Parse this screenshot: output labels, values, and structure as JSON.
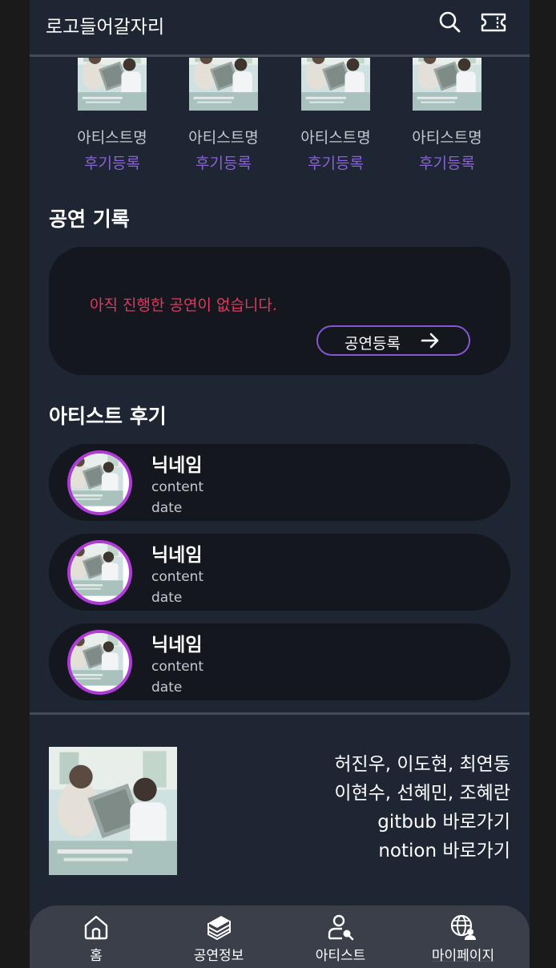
{
  "header": {
    "logo": "로고들어갈자리",
    "search_icon": "search-icon",
    "ticket_icon": "ticket-icon"
  },
  "thumbs": [
    {
      "name": "아티스트명",
      "review": "후기등록"
    },
    {
      "name": "아티스트명",
      "review": "후기등록"
    },
    {
      "name": "아티스트명",
      "review": "후기등록"
    },
    {
      "name": "아티스트명",
      "review": "후기등록"
    }
  ],
  "performance": {
    "title": "공연 기록",
    "empty_message": "아직 진행한 공연이 없습니다.",
    "register_label": "공연등록"
  },
  "reviews": {
    "title": "아티스트 후기",
    "items": [
      {
        "nickname": "닉네임",
        "content": "content",
        "date": "date"
      },
      {
        "nickname": "닉네임",
        "content": "content",
        "date": "date"
      },
      {
        "nickname": "닉네임",
        "content": "content",
        "date": "date"
      }
    ]
  },
  "footer": {
    "members_line1": "허진우, 이도현, 최연동",
    "members_line2": "이현수, 선혜민, 조혜란",
    "github_link": "gitbub 바로가기",
    "notion_link": "notion 바로가기"
  },
  "nav": {
    "items": [
      {
        "label": "홈",
        "icon": "home-icon"
      },
      {
        "label": "공연정보",
        "icon": "performance-stack-icon"
      },
      {
        "label": "아티스트",
        "icon": "artist-search-icon"
      },
      {
        "label": "마이페이지",
        "icon": "globe-user-icon"
      }
    ],
    "active": "마이페이지"
  },
  "colors": {
    "background": "#1e2533",
    "card": "#14171d",
    "accent_purple": "#8b63d9",
    "alert_pink": "#e0385f",
    "avatar_ring": "#b03bd9"
  }
}
